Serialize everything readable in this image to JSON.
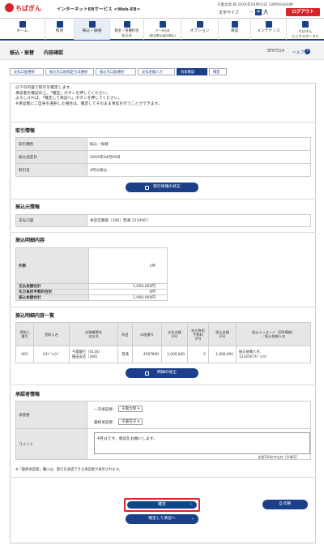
{
  "header": {
    "brand": "ちばぎん",
    "service": "インターネットEBサービス <Web-EB>",
    "user_line": "千葉太郎 様  20XX年04月02日 10時00分00秒",
    "text_size_label": "文字サイズ",
    "size_medium": "中",
    "size_large": "大",
    "logout_label": "ログアウト"
  },
  "nav": [
    {
      "label": "ホーム",
      "icon": "home-icon"
    },
    {
      "label": "照会",
      "icon": "search-icon"
    },
    {
      "label": "振込・振替",
      "icon": "transfer-icon"
    },
    {
      "label": "税金・各種料金\n払込み",
      "icon": "tax-icon"
    },
    {
      "label": "データ伝送\n(総合振込/給与振込)",
      "icon": "data-icon"
    },
    {
      "label": "オプション",
      "icon": "option-icon"
    },
    {
      "label": "承認",
      "icon": "approve-icon"
    },
    {
      "label": "メンテナンス",
      "icon": "maintenance-icon"
    },
    {
      "label": "ちばぎん\nビジネスポータル",
      "icon": "portal-icon"
    }
  ],
  "page": {
    "title": "振込・振替　　内容確認",
    "id": "BFKF024",
    "help": "ヘルプ"
  },
  "steps": [
    "支払口座選択",
    "振込先口座指定方法選択",
    "振込先口座選択",
    "支払金額入力",
    "内容確認",
    "確定"
  ],
  "intro": [
    "以下の内容で取引を確定します。",
    "承認者を確認の上、「確定」ボタンを押してください。",
    "よろしければ、「確定して承認へ」ボタンを押してください。",
    "※承認者にご自身を選択した場合は、確定してそのまま承認を行うことができます。"
  ],
  "trade_info": {
    "heading": "取引情報",
    "rows": [
      {
        "k": "取引種別",
        "v": "振込・振替"
      },
      {
        "k": "振込指定日",
        "v": "20XX年04月09日"
      },
      {
        "k": "取引名",
        "v": "4月分振込"
      }
    ],
    "edit_button": "取引情報の修正"
  },
  "source": {
    "heading": "振込元情報",
    "rows": [
      {
        "k": "支払口座",
        "v": "本店営業部（100）普通 1234567"
      }
    ]
  },
  "details": {
    "heading": "振込明細内容",
    "rows": [
      {
        "k": "件数",
        "v": "1件"
      },
      {
        "k": "支払金額合計",
        "v": "1,000,000円"
      },
      {
        "k": "先方負担手数料合計",
        "v": "0円"
      },
      {
        "k": "振込金額合計",
        "v": "1,000,000円"
      }
    ]
  },
  "detail_list": {
    "heading": "振込明細内容一覧",
    "headers": [
      "受取人\n番号",
      "受取人名",
      "金融機関名\n支店名",
      "科目",
      "口座番号",
      "支払金額\n(円)",
      "先方負担\n手数料\n(円)",
      "振込金額\n(円)",
      "振込メッセージ（EDI情報）\n／振込依頼人名"
    ],
    "row": [
      "001",
      "ｶ)ﾁﾊﾞｼｮｳｼﾞ",
      "千葉銀行（0134）\n稲田支店（266）",
      "普通",
      "4567890",
      "1,000,000",
      "0",
      "1,000,000",
      "振込依頼人名：\n1234567ﾁﾊﾞｼｮｳｼﾞ"
    ],
    "edit_button": "明細の修正"
  },
  "approver": {
    "heading": "承認者情報",
    "approver_label": "承認者",
    "first_label": "一次承認者：",
    "first_value": "千葉太郎",
    "final_label": "最終承認者：",
    "final_value": "千葉花子",
    "comment_label": "コメント",
    "comment": "4月分です。承認をお願いします。",
    "counter": "全角120文字以内［半角可］"
  },
  "note": "※「最終承認者」欄には、取引を承認できる承認者が表示されます。",
  "buttons": {
    "confirm": "確定",
    "print": "印刷",
    "confirm_approve": "確定して承認へ"
  }
}
